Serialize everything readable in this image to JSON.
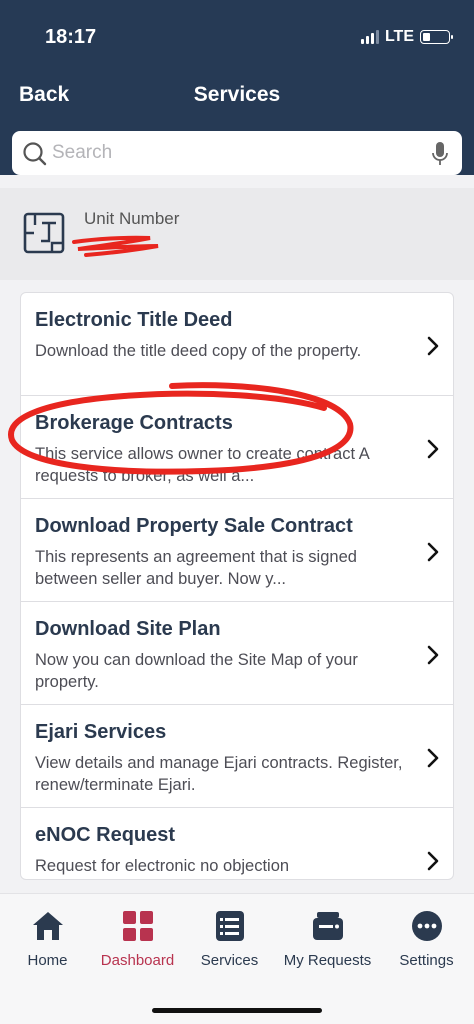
{
  "status_bar": {
    "time": "18:17",
    "network": "LTE"
  },
  "nav": {
    "back_label": "Back",
    "title": "Services"
  },
  "search": {
    "placeholder": "Search",
    "value": ""
  },
  "unit": {
    "label": "Unit Number"
  },
  "services": [
    {
      "title": "Electronic Title Deed",
      "description": "Download the title deed copy of the property."
    },
    {
      "title": "Brokerage Contracts",
      "description": "This service allows owner to create contract A requests to broker, as well a..."
    },
    {
      "title": "Download Property Sale Contract",
      "description": "This represents an agreement that is signed between seller and buyer. Now y..."
    },
    {
      "title": "Download Site Plan",
      "description": "Now you can download the Site Map of your property."
    },
    {
      "title": "Ejari Services",
      "description": "View details and manage Ejari contracts. Register, renew/terminate Ejari."
    },
    {
      "title": "eNOC Request",
      "description": "Request for electronic no objection"
    }
  ],
  "tabs": [
    {
      "label": "Home",
      "icon": "home-icon"
    },
    {
      "label": "Dashboard",
      "icon": "dashboard-icon",
      "active": true
    },
    {
      "label": "Services",
      "icon": "services-list-icon"
    },
    {
      "label": "My Requests",
      "icon": "wallet-icon"
    },
    {
      "label": "Settings",
      "icon": "more-icon"
    }
  ],
  "colors": {
    "header": "#263a55",
    "accent": "#b8334f",
    "annotation": "#e8261f"
  }
}
